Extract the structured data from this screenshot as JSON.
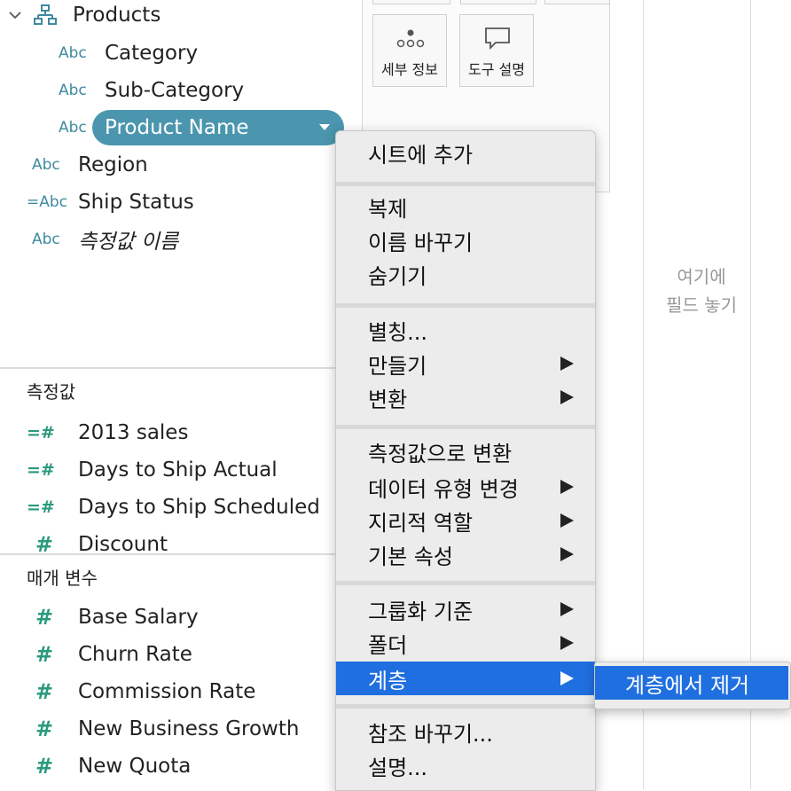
{
  "data_pane": {
    "dimensions": [
      {
        "label": "Products",
        "type": "hierarchy",
        "indent": 0
      },
      {
        "label": "Category",
        "type": "Abc",
        "indent": 1
      },
      {
        "label": "Sub-Category",
        "type": "Abc",
        "indent": 1
      },
      {
        "label": "Product Name",
        "type": "Abc",
        "indent": 1,
        "selected": true
      },
      {
        "label": "Region",
        "type": "Abc",
        "indent": 0
      },
      {
        "label": "Ship Status",
        "type": "=Abc",
        "indent": 0
      },
      {
        "label": "측정값 이름",
        "type": "Abc",
        "indent": 0
      }
    ],
    "measures_title": "측정값",
    "measures": [
      {
        "label": "2013 sales",
        "type": "=#"
      },
      {
        "label": "Days to Ship Actual",
        "type": "=#"
      },
      {
        "label": "Days to Ship Scheduled",
        "type": "=#"
      },
      {
        "label": "Discount",
        "type": "#"
      }
    ],
    "parameters_title": "매개 변수",
    "parameters": [
      {
        "label": "Base Salary",
        "type": "#"
      },
      {
        "label": "Churn Rate",
        "type": "#"
      },
      {
        "label": "Commission Rate",
        "type": "#"
      },
      {
        "label": "New Business Growth",
        "type": "#"
      },
      {
        "label": "New Quota",
        "type": "#"
      }
    ]
  },
  "marks": {
    "detail_label": "세부 정보",
    "tooltip_label": "도구 설명"
  },
  "dropzone": {
    "line1": "여기에",
    "line2": "필드 놓기"
  },
  "context_menu": {
    "add_to_sheet": "시트에 추가",
    "duplicate": "복제",
    "rename": "이름 바꾸기",
    "hide": "숨기기",
    "aliases": "별칭...",
    "create": "만들기",
    "transform": "변환",
    "convert_to_measure": "측정값으로 변환",
    "change_data_type": "데이터 유형 변경",
    "geographic_role": "지리적 역할",
    "default_properties": "기본 속성",
    "group_by": "그룹화 기준",
    "folders": "폴더",
    "hierarchy": "계층",
    "replace_references": "참조 바꾸기...",
    "describe": "설명..."
  },
  "submenu": {
    "remove_from_hierarchy": "계층에서 제거"
  },
  "colors": {
    "pill": "#4b96ae",
    "menu_highlight": "#1f6fe0",
    "abc_icon": "#3e8a9f",
    "hash_icon": "#2a9a7e"
  }
}
